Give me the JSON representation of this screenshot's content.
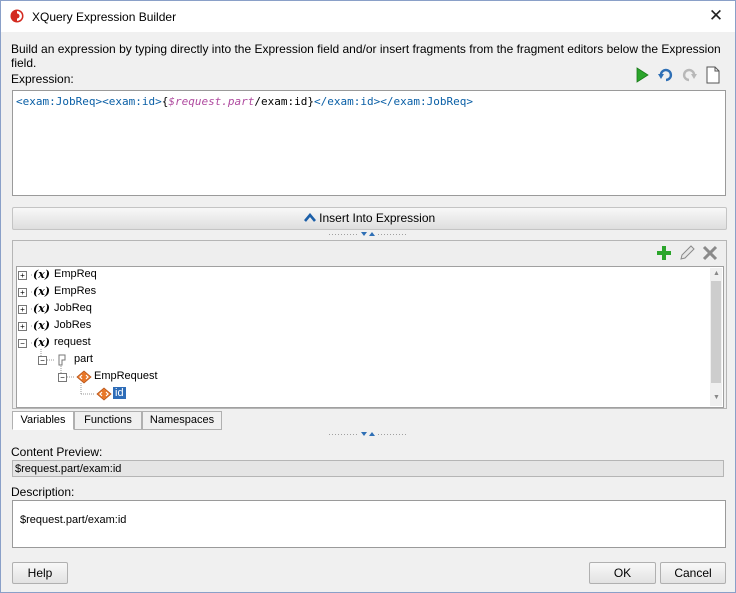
{
  "window": {
    "title": "XQuery Expression Builder"
  },
  "instructions": "Build an expression by typing directly into the Expression field and/or insert fragments from the fragment editors below the Expression field.",
  "expression": {
    "label": "Expression:",
    "parts": {
      "open_tags": "<exam:JobReq><exam:id>",
      "brace_open": "{",
      "variable": "$request.part",
      "path": "/exam:id",
      "brace_close": "}",
      "close_tags": "</exam:id></exam:JobReq>"
    }
  },
  "toolbar": {
    "icons": [
      "run-icon",
      "undo-icon",
      "redo-icon",
      "new-document-icon"
    ]
  },
  "insert_button": "Insert Into Expression",
  "tree": {
    "items": [
      {
        "label": "EmpReq"
      },
      {
        "label": "EmpRes"
      },
      {
        "label": "JobReq"
      },
      {
        "label": "JobRes"
      },
      {
        "label": "request"
      },
      {
        "label": "part"
      },
      {
        "label": "EmpRequest"
      },
      {
        "label": "id"
      }
    ]
  },
  "tabs": [
    "Variables",
    "Functions",
    "Namespaces"
  ],
  "content_preview": {
    "label": "Content Preview:",
    "value": "$request.part/exam:id"
  },
  "description": {
    "label": "Description:",
    "value": "$request.part/exam:id"
  },
  "buttons": {
    "help": "Help",
    "ok": "OK",
    "cancel": "Cancel"
  },
  "colors": {
    "tag": "#0a5fa6",
    "variable": "#b04ca0",
    "selection": "#2f6db8",
    "run_green": "#2ba52b"
  }
}
